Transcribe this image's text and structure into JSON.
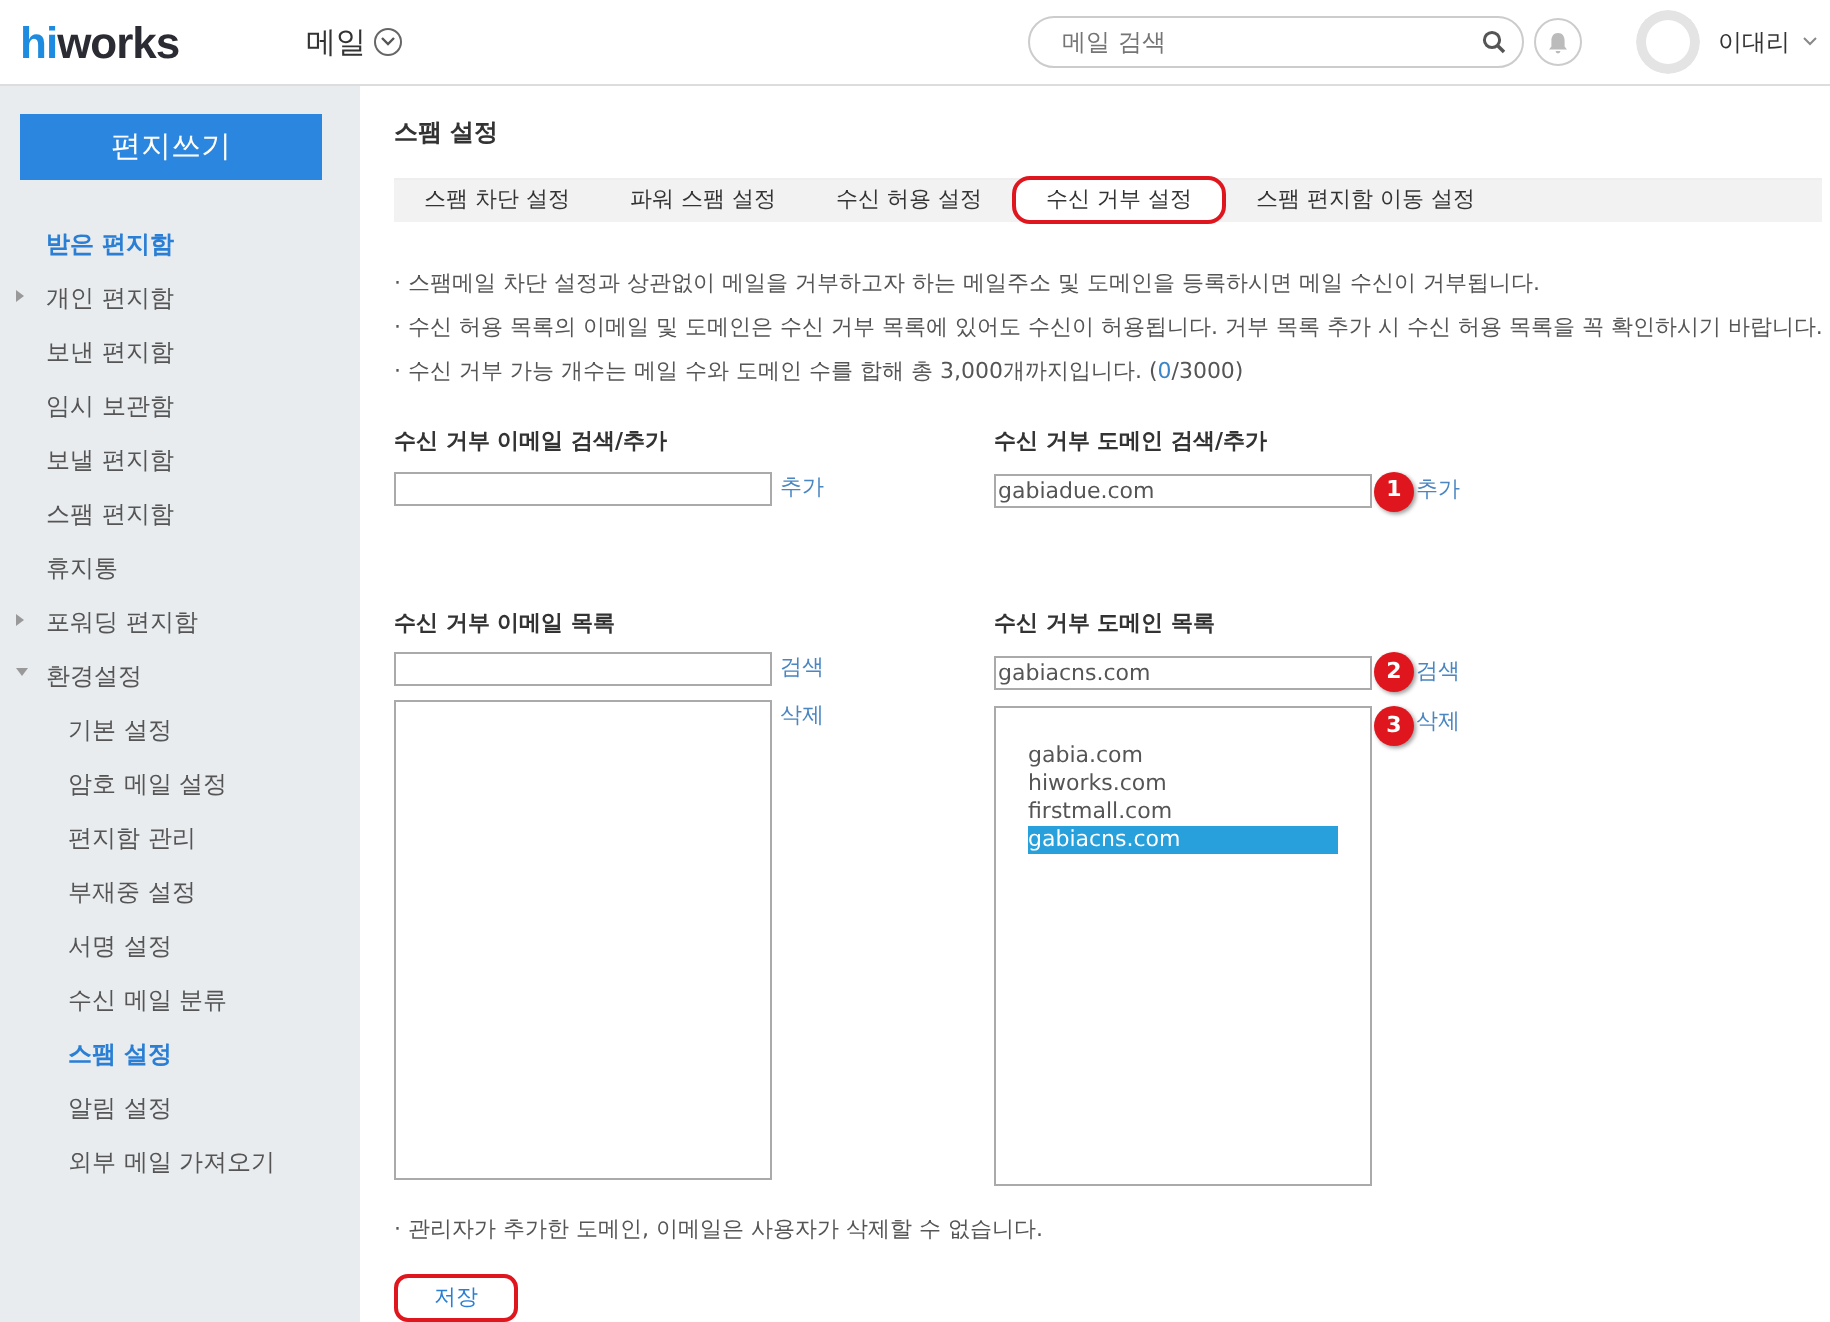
{
  "header": {
    "logo": {
      "accent": "hi",
      "rest": "works"
    },
    "app_menu": "메일",
    "search": {
      "placeholder": "메일 검색"
    },
    "user": "이대리"
  },
  "sidebar": {
    "compose_button": "편지쓰기",
    "items": [
      {
        "label": "받은 편지함",
        "selected": true
      },
      {
        "label": "개인 편지함",
        "selected": false,
        "expanded": false
      },
      {
        "label": "보낸 편지함",
        "selected": false
      },
      {
        "label": "임시 보관함",
        "selected": false
      },
      {
        "label": "보낼 편지함",
        "selected": false
      },
      {
        "label": "스팸 편지함",
        "selected": false
      },
      {
        "label": "휴지통",
        "selected": false
      },
      {
        "label": "포워딩 편지함",
        "selected": false,
        "expanded": false
      },
      {
        "label": "환경설정",
        "selected": false,
        "expanded": true,
        "children": [
          {
            "label": "기본 설정",
            "selected": false
          },
          {
            "label": "암호 메일 설정",
            "selected": false
          },
          {
            "label": "편지함 관리",
            "selected": false
          },
          {
            "label": "부재중 설정",
            "selected": false
          },
          {
            "label": "서명 설정",
            "selected": false
          },
          {
            "label": "수신 메일 분류",
            "selected": false
          },
          {
            "label": "스팸 설정",
            "selected": true
          },
          {
            "label": "알림 설정",
            "selected": false
          },
          {
            "label": "외부 메일 가져오기",
            "selected": false
          }
        ]
      }
    ]
  },
  "page_title": "스팸 설정",
  "tabs": [
    {
      "label": "스팸 차단 설정",
      "selected": false,
      "highlighted": false
    },
    {
      "label": "파워 스팸 설정",
      "selected": false,
      "highlighted": false
    },
    {
      "label": "수신 허용 설정",
      "selected": false,
      "highlighted": false
    },
    {
      "label": "수신 거부 설정",
      "selected": true,
      "highlighted": true
    },
    {
      "label": "스팸 편지함 이동 설정",
      "selected": false,
      "highlighted": false
    }
  ],
  "notes": [
    {
      "text": "· 스팸메일 차단 설정과 상관없이 메일을 거부하고자 하는 메일주소 및 도메인을 등록하시면 메일 수신이 거부됩니다."
    },
    {
      "text": "· 수신 허용 목록의 이메일 및 도메인은 수신 거부 목록에 있어도 수신이 허용됩니다. 거부 목록 추가 시 수신 허용 목록을 꼭 확인하시기 바랍니다."
    },
    {
      "text": "· 수신 거부 가능 개수는 메일 수와 도메인 수를 합해 총 3,000개까지입니다. (",
      "count": "0",
      "suffix": "/3000)"
    }
  ],
  "add_sections": [
    {
      "label": "수신 거부 이메일 검색/추가",
      "action": "추가"
    },
    {
      "label": "수신 거부 도메인 검색/추가",
      "value": "gabiadue.com",
      "action": "추가",
      "marker": "1"
    }
  ],
  "list_sections": [
    {
      "label": "수신 거부 이메일 목록",
      "search_action": "검색",
      "delete_action": "삭제"
    },
    {
      "label": "수신 거부 도메인 목록",
      "filter": "gabiacns.com",
      "search_action": "검색",
      "search_marker": "2",
      "delete_action": "삭제",
      "delete_marker": "3",
      "items": [
        {
          "label": "gabia.com",
          "selected": false
        },
        {
          "label": "hiworks.com",
          "selected": false
        },
        {
          "label": "firstmall.com",
          "selected": false
        },
        {
          "label": "gabiacns.com",
          "selected": true
        }
      ]
    }
  ],
  "footer_note": "· 관리자가 추가한 도메인, 이메일은 사용자가 삭제할 수 없습니다.",
  "save_button": {
    "label": "저장",
    "highlighted": true
  }
}
